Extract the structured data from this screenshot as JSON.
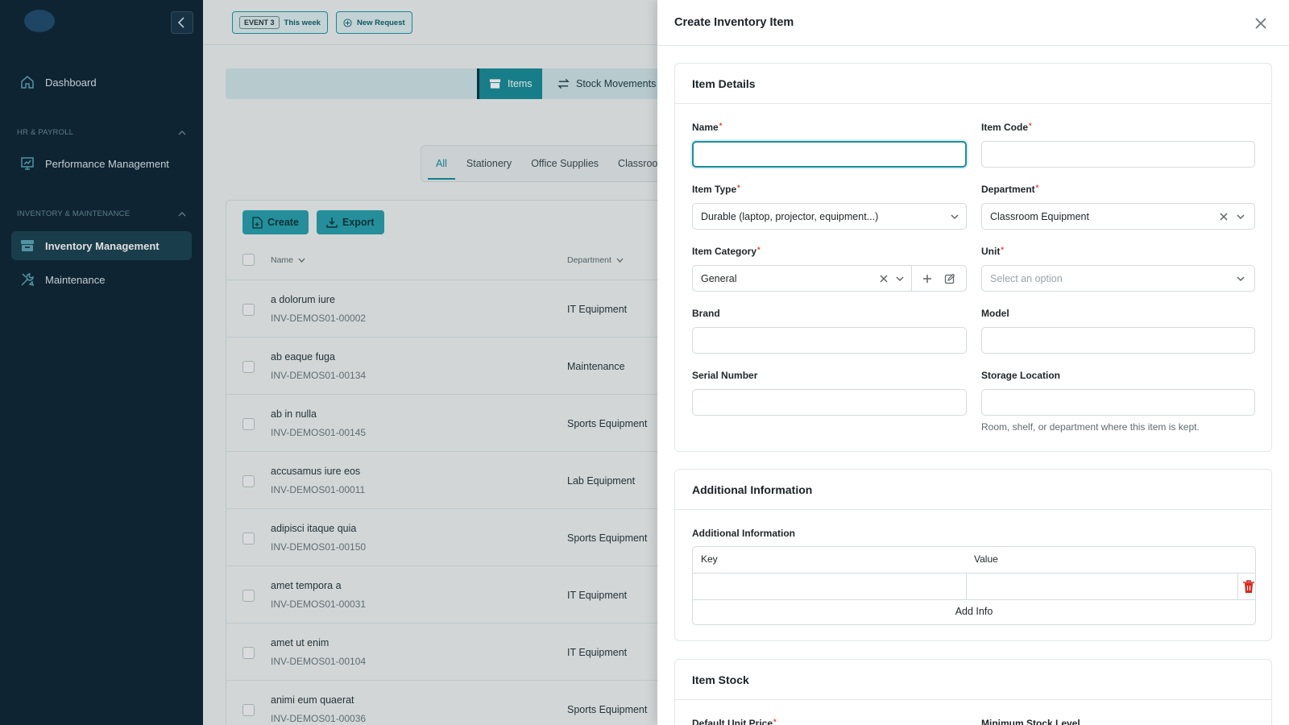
{
  "sidebar": {
    "items": [
      {
        "label": "Dashboard",
        "icon": "home-icon"
      },
      {
        "label": "Performance Management",
        "icon": "chart-board-icon"
      },
      {
        "label": "Inventory Management",
        "icon": "archive-box-icon",
        "active": true
      },
      {
        "label": "Maintenance",
        "icon": "tools-icon"
      }
    ],
    "sections": [
      "HR & PAYROLL",
      "INVENTORY & MAINTENANCE"
    ]
  },
  "topbar": {
    "event_tag": "EVENT 3",
    "event_label": "This week",
    "new_request": "New Request"
  },
  "tabs": [
    {
      "label": "Items",
      "active": true
    },
    {
      "label": "Stock Movements",
      "active": false
    }
  ],
  "category_tabs": [
    "All",
    "Stationery",
    "Office Supplies",
    "Classroo"
  ],
  "toolbar": {
    "create": "Create",
    "export": "Export"
  },
  "table": {
    "columns": [
      "Name",
      "Department"
    ],
    "rows": [
      {
        "name": "a dolorum iure",
        "code": "INV-DEMOS01-00002",
        "department": "IT Equipment"
      },
      {
        "name": "ab eaque fuga",
        "code": "INV-DEMOS01-00134",
        "department": "Maintenance"
      },
      {
        "name": "ab in nulla",
        "code": "INV-DEMOS01-00145",
        "department": "Sports Equipment"
      },
      {
        "name": "accusamus iure eos",
        "code": "INV-DEMOS01-00011",
        "department": "Lab Equipment"
      },
      {
        "name": "adipisci itaque quia",
        "code": "INV-DEMOS01-00150",
        "department": "Sports Equipment"
      },
      {
        "name": "amet tempora a",
        "code": "INV-DEMOS01-00031",
        "department": "IT Equipment"
      },
      {
        "name": "amet ut enim",
        "code": "INV-DEMOS01-00104",
        "department": "IT Equipment"
      },
      {
        "name": "animi eum quaerat",
        "code": "INV-DEMOS01-00036",
        "department": "Sports Equipment"
      }
    ]
  },
  "drawer": {
    "title": "Create Inventory Item",
    "item_details": {
      "title": "Item Details",
      "name_label": "Name",
      "name_value": "",
      "item_code_label": "Item Code",
      "item_code_value": "",
      "item_type_label": "Item Type",
      "item_type_value": "Durable (laptop, projector, equipment...)",
      "department_label": "Department",
      "department_value": "Classroom Equipment",
      "item_category_label": "Item Category",
      "item_category_value": "General",
      "unit_label": "Unit",
      "unit_placeholder": "Select an option",
      "brand_label": "Brand",
      "model_label": "Model",
      "serial_label": "Serial Number",
      "storage_label": "Storage Location",
      "storage_hint": "Room, shelf, or department where this item is kept."
    },
    "additional": {
      "title": "Additional Information",
      "label": "Additional Information",
      "key_header": "Key",
      "value_header": "Value",
      "add_info": "Add Info"
    },
    "stock": {
      "title": "Item Stock",
      "price_label": "Default Unit Price",
      "min_stock_label": "Minimum Stock Level"
    }
  },
  "colors": {
    "accent": "#1a8f9c",
    "sidebar": "#10293a",
    "required": "#e0352b"
  }
}
